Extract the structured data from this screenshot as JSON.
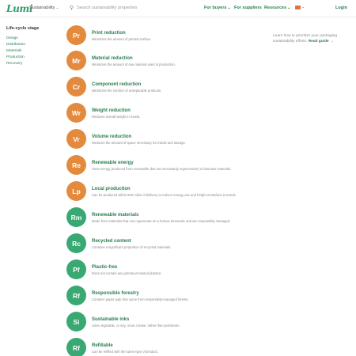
{
  "header": {
    "logo": "Lumi",
    "topic": "Sustainability",
    "search_placeholder": "Search sustainability properties",
    "nav": [
      {
        "label": "For buyers",
        "dropdown": true
      },
      {
        "label": "For suppliers",
        "dropdown": false
      },
      {
        "label": "Resources",
        "dropdown": true
      }
    ],
    "login": "Login",
    "flag_color": "#e4703a"
  },
  "sidebar": {
    "heading": "Life-cycle stage",
    "items": [
      "Design",
      "Distribution",
      "Materials",
      "Production",
      "Recovery"
    ]
  },
  "properties": [
    {
      "abbr": "Pr",
      "title": "Print reduction",
      "description": "Minimizes the amount of printed surface.",
      "color": "orange"
    },
    {
      "abbr": "Mr",
      "title": "Material reduction",
      "description": "Minimizes the amount of raw material used in production.",
      "color": "orange"
    },
    {
      "abbr": "Cr",
      "title": "Component reduction",
      "description": "Minimizes the number of unseparable products.",
      "color": "orange"
    },
    {
      "abbr": "Wr",
      "title": "Weight reduction",
      "description": "Reduces overall weight in transit.",
      "color": "orange"
    },
    {
      "abbr": "Vr",
      "title": "Volume reduction",
      "description": "Reduces the amount of space necessary for transit and storage.",
      "color": "orange"
    },
    {
      "abbr": "Re",
      "title": "Renewable energy",
      "description": "Uses energy produced from renewable (but not necessarily regenerative) or biomass materials.",
      "color": "orange"
    },
    {
      "abbr": "Lp",
      "title": "Local production",
      "description": "Can be produced within 500 miles of delivery to reduce energy use and freight emissions in transit.",
      "color": "orange"
    },
    {
      "abbr": "Rm",
      "title": "Renewable materials",
      "description": "Made from materials that can regenerate on a human timescale and are responsibly managed.",
      "color": "green"
    },
    {
      "abbr": "Rc",
      "title": "Recycled content",
      "description": "Contains a significant proportion of recycled materials.",
      "color": "green"
    },
    {
      "abbr": "Pf",
      "title": "Plastic-free",
      "description": "Does not contain any petroleum-based plastics.",
      "color": "green"
    },
    {
      "abbr": "Rf",
      "title": "Responsible forestry",
      "description": "Contains paper pulp that came from responsibly-managed forests.",
      "color": "green"
    },
    {
      "abbr": "Si",
      "title": "Sustainable inks",
      "description": "Uses vegetable, or soy, oil as a base, rather than petroleum.",
      "color": "green"
    },
    {
      "abbr": "Rf",
      "title": "Refillable",
      "description": "Can be refilled with the same type of product.",
      "color": "green"
    }
  ],
  "aside": {
    "text": "Learn how to prioritize your packaging sustainability efforts.",
    "link": "Read guide →"
  }
}
